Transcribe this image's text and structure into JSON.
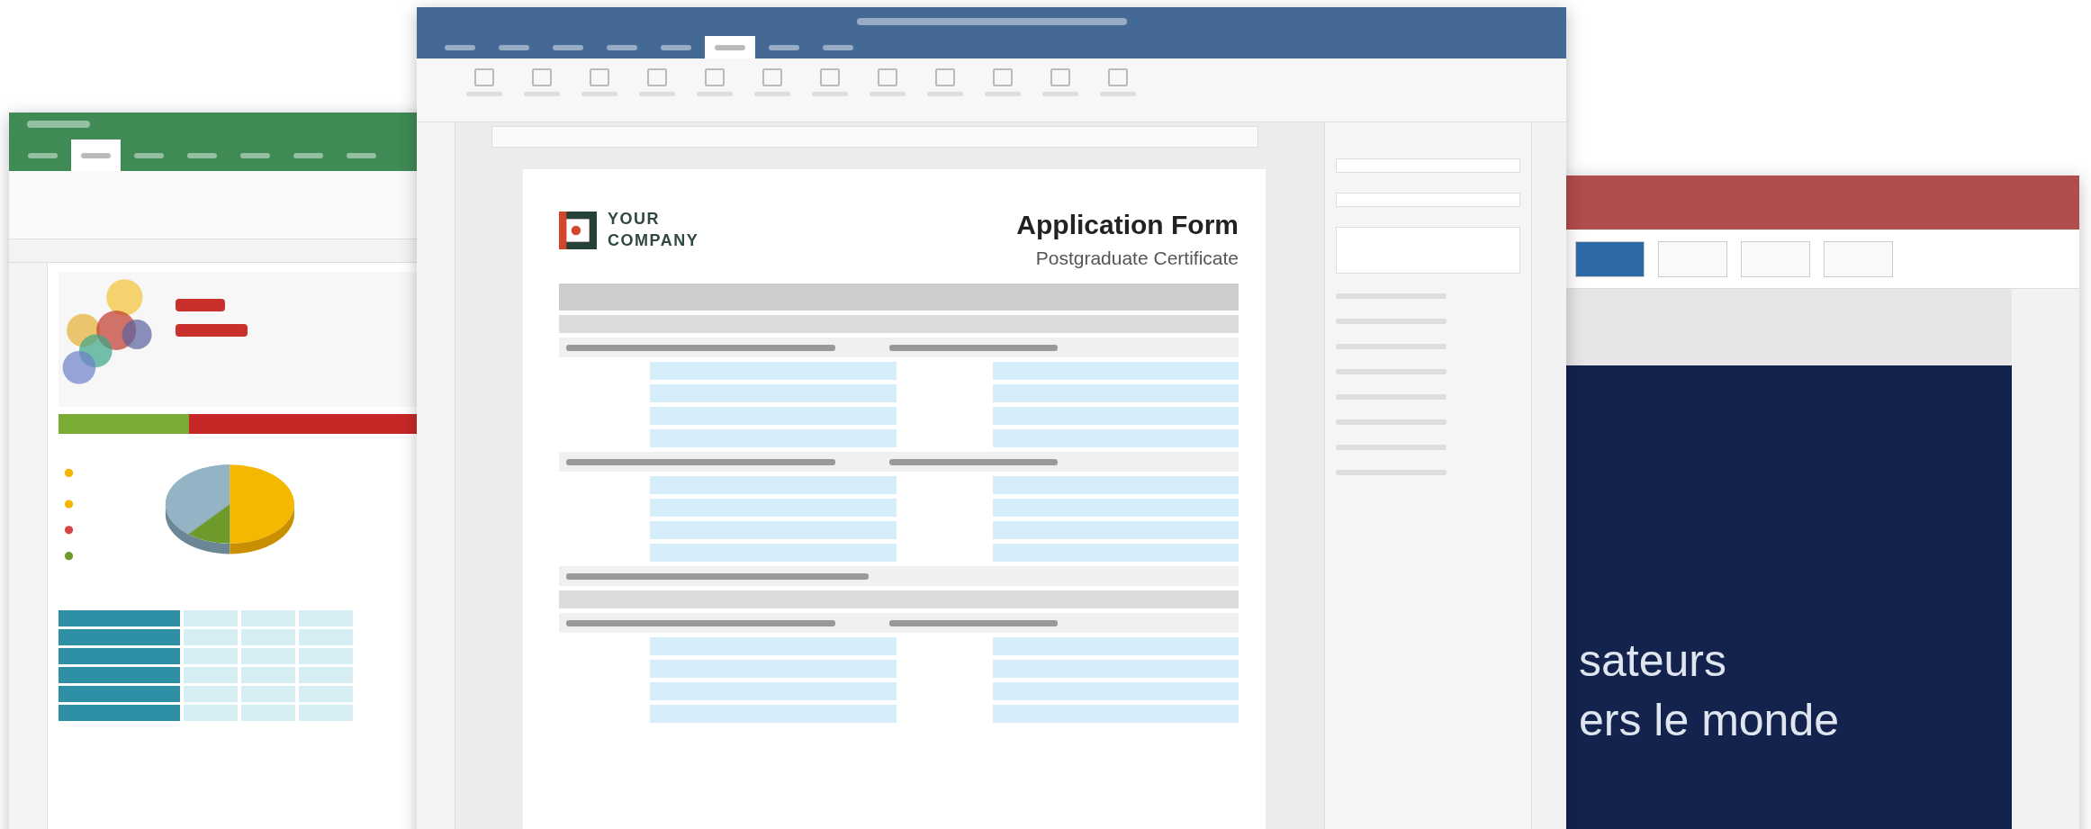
{
  "spreadsheet_window": {
    "tabs": [
      {
        "selected": false
      },
      {
        "selected": true
      },
      {
        "selected": false
      },
      {
        "selected": false
      },
      {
        "selected": false
      },
      {
        "selected": false
      },
      {
        "selected": false
      }
    ]
  },
  "document_window": {
    "tabs": [
      {
        "selected": false
      },
      {
        "selected": false
      },
      {
        "selected": false
      },
      {
        "selected": false
      },
      {
        "selected": false
      },
      {
        "selected": true
      },
      {
        "selected": false
      },
      {
        "selected": false
      }
    ],
    "page": {
      "logo_lines": [
        "YOUR",
        "COMPANY"
      ],
      "title": "Application Form",
      "subtitle": "Postgraduate Certificate"
    }
  },
  "presentation_window": {
    "slide": {
      "lines": [
        "sateurs",
        "ers le monde"
      ]
    }
  }
}
